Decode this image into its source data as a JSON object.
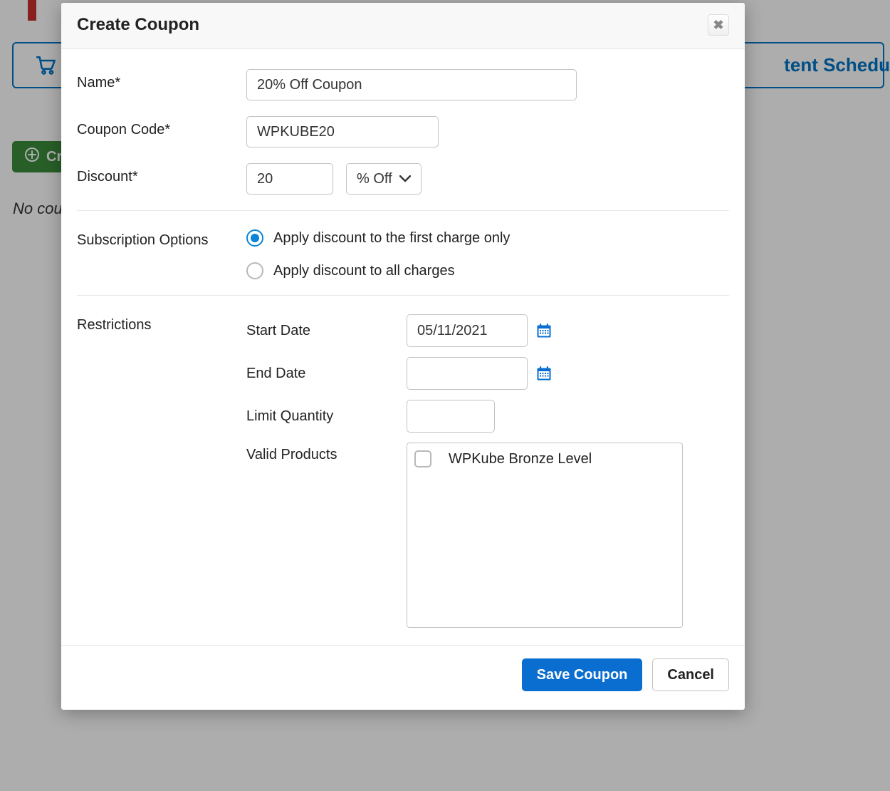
{
  "modal": {
    "title": "Create Coupon",
    "close_symbol": "✖"
  },
  "form": {
    "name": {
      "label": "Name*",
      "value": "20% Off Coupon"
    },
    "code": {
      "label": "Coupon Code*",
      "value": "WPKUBE20"
    },
    "discount": {
      "label": "Discount*",
      "value": "20",
      "type_label": "% Off"
    },
    "subscription": {
      "label": "Subscription Options",
      "option_first": "Apply discount to the first charge only",
      "option_all": "Apply discount to all charges"
    },
    "restrictions": {
      "label": "Restrictions",
      "start_date_label": "Start Date",
      "start_date_value": "05/11/2021",
      "end_date_label": "End Date",
      "end_date_value": "",
      "limit_qty_label": "Limit Quantity",
      "limit_qty_value": "",
      "valid_products_label": "Valid Products",
      "product_1": "WPKube Bronze Level"
    }
  },
  "footer": {
    "save_label": "Save Coupon",
    "cancel_label": "Cancel"
  },
  "background": {
    "create_label": "Cr",
    "empty_label": "No coup",
    "tent_sched": "tent Schedu"
  }
}
